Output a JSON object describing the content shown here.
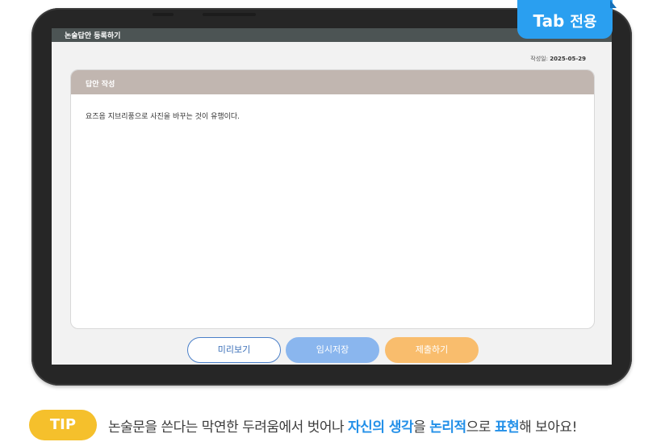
{
  "screen": {
    "title": "논술답안 등록하기",
    "date_label": "작성일:",
    "date_value": "2025-05-29",
    "card": {
      "header": "답안 작성",
      "answer_text": "요즈음 지브리풍으로 사진을 바꾸는 것이 유행이다."
    },
    "buttons": {
      "preview": "미리보기",
      "temp_save": "임시저장",
      "submit": "제출하기"
    }
  },
  "badge": {
    "prefix": "Tab",
    "suffix": "전용"
  },
  "tip": {
    "label": "TIP",
    "segments": [
      "논술문을 쓴다는 막연한 두려움에서 벗어나 ",
      "자신의 생각",
      "을 ",
      "논리적",
      "으로 ",
      "표현",
      "해 보아요!"
    ]
  },
  "colors": {
    "accent_blue": "#2390e8",
    "tip_yellow": "#f5c02c",
    "submit_orange": "#f9bd6d",
    "save_blue": "#8ab6ee"
  }
}
